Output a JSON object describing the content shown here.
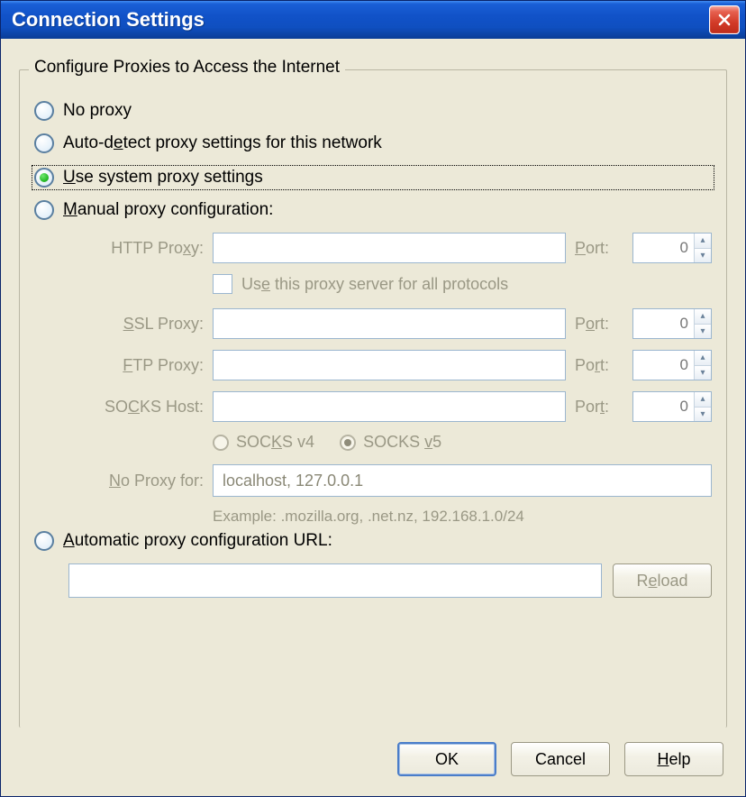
{
  "window": {
    "title": "Connection Settings"
  },
  "group": {
    "legend": "Configure Proxies to Access the Internet"
  },
  "radios": {
    "no_proxy": "No proxy",
    "auto_detect_pre": "Auto-d",
    "auto_detect_u": "e",
    "auto_detect_post": "tect proxy settings for this network",
    "use_system_u": "U",
    "use_system_post": "se system proxy settings",
    "manual_u": "M",
    "manual_post": "anual proxy configuration:",
    "pac_u": "A",
    "pac_post": "utomatic proxy configuration URL:"
  },
  "labels": {
    "http_pre": "HTTP Pro",
    "http_u": "x",
    "http_post": "y:",
    "ssl_u": "S",
    "ssl_post": "SL Proxy:",
    "ftp_u": "F",
    "ftp_post": "TP Proxy:",
    "socks_pre": "SO",
    "socks_u": "C",
    "socks_post": "KS Host:",
    "noproxy_u": "N",
    "noproxy_post": "o Proxy for:",
    "port_u": "P",
    "port_post": "ort:"
  },
  "checkbox": {
    "use_all_pre": "Us",
    "use_all_u": "e",
    "use_all_post": " this proxy server for all protocols"
  },
  "socks": {
    "v4_pre": "SOC",
    "v4_u": "K",
    "v4_post": "S v4",
    "v5_pre": "SOCKS ",
    "v5_u": "v",
    "v5_post": "5"
  },
  "values": {
    "http_host": "",
    "http_port": "0",
    "ssl_host": "",
    "ssl_port": "0",
    "ftp_host": "",
    "ftp_port": "0",
    "socks_host": "",
    "socks_port": "0",
    "no_proxy_for": "localhost, 127.0.0.1",
    "example": "Example: .mozilla.org, .net.nz, 192.168.1.0/24",
    "pac_url": ""
  },
  "buttons": {
    "reload_pre": "R",
    "reload_u": "e",
    "reload_post": "load",
    "ok": "OK",
    "cancel": "Cancel",
    "help_u": "H",
    "help_post": "elp"
  }
}
